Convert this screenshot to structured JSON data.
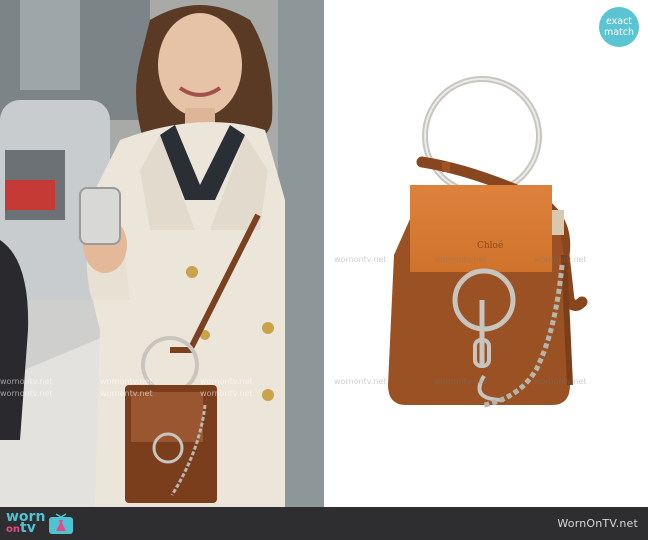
{
  "badge": {
    "line1": "exact",
    "line2": "match"
  },
  "footer": {
    "logo": {
      "part1": "worn",
      "part2": "on",
      "part3": "tv"
    },
    "site": "WornOnTV.net"
  },
  "watermark": "wornontv.net",
  "product": {
    "logo_text": "Chloé"
  },
  "colors": {
    "accent": "#5bc4d3",
    "footer": "#2e2e30",
    "bag_brown": "#8e4e22",
    "suede": "#d77a33"
  }
}
